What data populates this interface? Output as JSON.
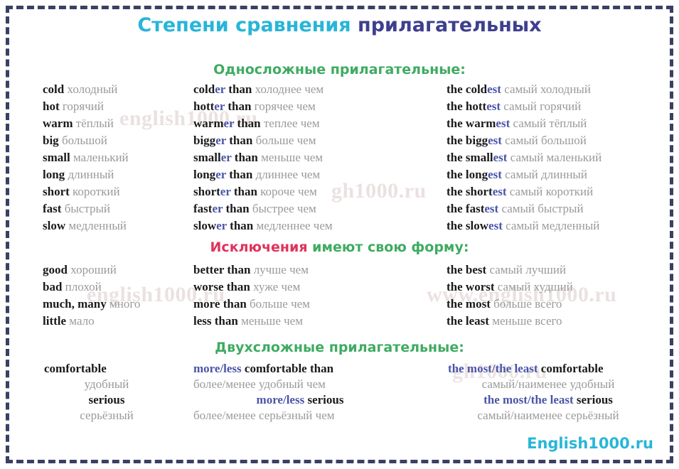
{
  "title": {
    "part1": "Степени сравнения ",
    "part2": "прилагательных"
  },
  "colors": {
    "title_cyan": "#28b5d8",
    "title_navy": "#3f3f8f",
    "heading_green": "#3fab62",
    "heading_red": "#e0325b",
    "suffix_blue": "#4a55a8",
    "russian_gray": "#9a9a9a",
    "english_black": "#1a1a1a",
    "border_navy": "#3b3f63",
    "logo_cyan": "#29b6d8"
  },
  "sections": [
    {
      "heading": {
        "green": "Односложные прилагательные:",
        "red": ""
      },
      "rows": [
        {
          "positive_en": "cold",
          "positive_ru": "холодный",
          "comparative_stem": "cold",
          "comparative_suffix": "er",
          "comparative_tail": " than",
          "comparative_ru": "холоднее чем",
          "superlative_prefix": "the ",
          "superlative_stem": "cold",
          "superlative_suffix": "est",
          "superlative_ru": "самый холодный"
        },
        {
          "positive_en": "hot",
          "positive_ru": "горячий",
          "comparative_stem": "hott",
          "comparative_suffix": "er",
          "comparative_tail": " than",
          "comparative_ru": "горячее чем",
          "superlative_prefix": "the ",
          "superlative_stem": "hott",
          "superlative_suffix": "est",
          "superlative_ru": "самый горячий"
        },
        {
          "positive_en": "warm",
          "positive_ru": "тёплый",
          "comparative_stem": "warm",
          "comparative_suffix": "er",
          "comparative_tail": " than",
          "comparative_ru": "теплее чем",
          "superlative_prefix": "the ",
          "superlative_stem": "warm",
          "superlative_suffix": "est",
          "superlative_ru": "самый тёплый"
        },
        {
          "positive_en": "big",
          "positive_ru": "большой",
          "comparative_stem": "bigg",
          "comparative_suffix": "er",
          "comparative_tail": " than",
          "comparative_ru": "больше чем",
          "superlative_prefix": "the ",
          "superlative_stem": "bigg",
          "superlative_suffix": "est",
          "superlative_ru": "самый большой"
        },
        {
          "positive_en": "small",
          "positive_ru": "маленький",
          "comparative_stem": "small",
          "comparative_suffix": "er",
          "comparative_tail": " than",
          "comparative_ru": "меньше чем",
          "superlative_prefix": "the ",
          "superlative_stem": "small",
          "superlative_suffix": "est",
          "superlative_ru": "самый маленький"
        },
        {
          "positive_en": "long",
          "positive_ru": "длинный",
          "comparative_stem": "long",
          "comparative_suffix": "er",
          "comparative_tail": " than",
          "comparative_ru": "длиннее чем",
          "superlative_prefix": "the ",
          "superlative_stem": "long",
          "superlative_suffix": "est",
          "superlative_ru": "самый длинный"
        },
        {
          "positive_en": "short",
          "positive_ru": "короткий",
          "comparative_stem": "short",
          "comparative_suffix": "er",
          "comparative_tail": " than",
          "comparative_ru": "короче чем",
          "superlative_prefix": "the ",
          "superlative_stem": "short",
          "superlative_suffix": "est",
          "superlative_ru": "самый короткий"
        },
        {
          "positive_en": "fast",
          "positive_ru": "быстрый",
          "comparative_stem": "fast",
          "comparative_suffix": "er",
          "comparative_tail": " than",
          "comparative_ru": "быстрее чем",
          "superlative_prefix": "the ",
          "superlative_stem": "fast",
          "superlative_suffix": "est",
          "superlative_ru": "самый быстрый"
        },
        {
          "positive_en": "slow",
          "positive_ru": "медленный",
          "comparative_stem": "slow",
          "comparative_suffix": "er",
          "comparative_tail": " than",
          "comparative_ru": "медленнее чем",
          "superlative_prefix": "the ",
          "superlative_stem": "slow",
          "superlative_suffix": "est",
          "superlative_ru": "самый медленный"
        }
      ]
    },
    {
      "heading": {
        "red": "Исключения",
        "green": " имеют свою форму:"
      },
      "rows": [
        {
          "positive_en": "good",
          "positive_ru": "хороший",
          "comparative_stem": "better",
          "comparative_suffix": "",
          "comparative_tail": " than",
          "comparative_ru": "лучше чем",
          "superlative_prefix": "the ",
          "superlative_stem": "best",
          "superlative_suffix": "",
          "superlative_ru": "самый лучший"
        },
        {
          "positive_en": "bad",
          "positive_ru": "плохой",
          "comparative_stem": "worse",
          "comparative_suffix": "",
          "comparative_tail": " than",
          "comparative_ru": "хуже чем",
          "superlative_prefix": "the ",
          "superlative_stem": "worst",
          "superlative_suffix": "",
          "superlative_ru": "самый худший"
        },
        {
          "positive_en": "much, many",
          "positive_ru": "много",
          "comparative_stem": "more",
          "comparative_suffix": "",
          "comparative_tail": " than",
          "comparative_ru": "больше чем",
          "superlative_prefix": "the ",
          "superlative_stem": "most",
          "superlative_suffix": "",
          "superlative_ru": "больше всего"
        },
        {
          "positive_en": "little",
          "positive_ru": "мало",
          "comparative_stem": "less",
          "comparative_suffix": "",
          "comparative_tail": " than",
          "comparative_ru": "меньше чем",
          "superlative_prefix": "the ",
          "superlative_stem": "least",
          "superlative_suffix": "",
          "superlative_ru": "меньше всего"
        }
      ]
    }
  ],
  "two_syllable": {
    "heading": "Двухсложные прилагательные:",
    "entries": [
      {
        "positive_en": "comfortable",
        "positive_ru": "удобный",
        "comparative_blue": "more/less",
        "comparative_black": " comfortable than",
        "comparative_ru": "более/менее удобный чем",
        "superlative_blue": "the most/the least",
        "superlative_black": " comfortable",
        "superlative_ru": "самый/наименее удобный"
      },
      {
        "positive_en": "serious",
        "positive_ru": "серьёзный",
        "comparative_blue": "more/less",
        "comparative_black": " serious",
        "comparative_ru": "более/менее серьёзный чем",
        "superlative_blue": "the most/the least",
        "superlative_black": " serious",
        "superlative_ru": "самый/наименее серьёзный"
      }
    ]
  },
  "watermark": {
    "text_a": "english1000.ru",
    "text_b": "www.english1000.ru",
    "text_c": "gh1000.ru"
  },
  "footer": {
    "logo": "English1000.ru"
  }
}
